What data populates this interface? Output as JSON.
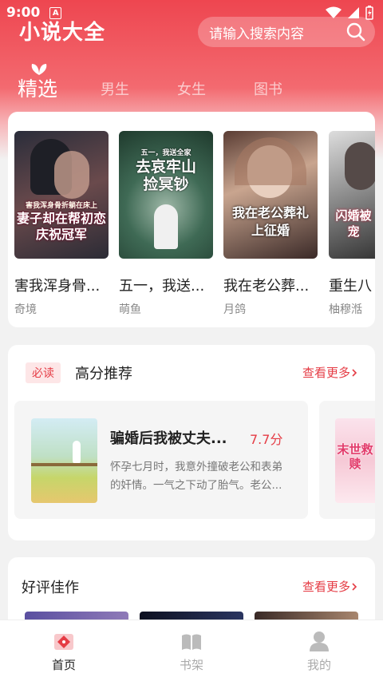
{
  "status": {
    "time": "9:00",
    "notification_icon": "A"
  },
  "header": {
    "app_title": "小说大全",
    "search_placeholder": "请输入搜索内容"
  },
  "tabs": [
    {
      "label": "精选",
      "active": true
    },
    {
      "label": "男生",
      "active": false
    },
    {
      "label": "女生",
      "active": false
    },
    {
      "label": "图书",
      "active": false
    }
  ],
  "featured_books": [
    {
      "title": "害我浑身骨...",
      "author": "奇境",
      "cover_text": "妻子却在帮初恋庆祝冠军",
      "cover_top": "害我浑身骨折躺在床上"
    },
    {
      "title": "五一，我送...",
      "author": "萌鱼",
      "cover_text": "去哀牢山捡冥钞",
      "cover_top": "五一，我送全家"
    },
    {
      "title": "我在老公葬...",
      "author": "月鸽",
      "cover_text": "我在老公葬礼上征婚",
      "cover_top": ""
    },
    {
      "title": "重生八",
      "author": "柚穆湉",
      "cover_text": "闪婚被宠",
      "cover_top": ""
    }
  ],
  "recommend": {
    "badge": "必读",
    "title": "高分推荐",
    "more": "查看更多",
    "book": {
      "title": "骗婚后我被丈夫...",
      "score": "7.7分",
      "desc": "怀孕七月时，我意外撞破老公和表弟的奸情。一气之下动了胎气。老公..."
    },
    "next_cover_text": "末世救赎"
  },
  "good_reviews": {
    "title": "好评佳作",
    "more": "查看更多"
  },
  "bottom_nav": [
    {
      "label": "首页",
      "icon": "home-icon",
      "active": true
    },
    {
      "label": "书架",
      "icon": "bookshelf-icon",
      "active": false
    },
    {
      "label": "我的",
      "icon": "profile-icon",
      "active": false
    }
  ],
  "colors": {
    "accent": "#e53c45",
    "header": "#ee4650"
  }
}
